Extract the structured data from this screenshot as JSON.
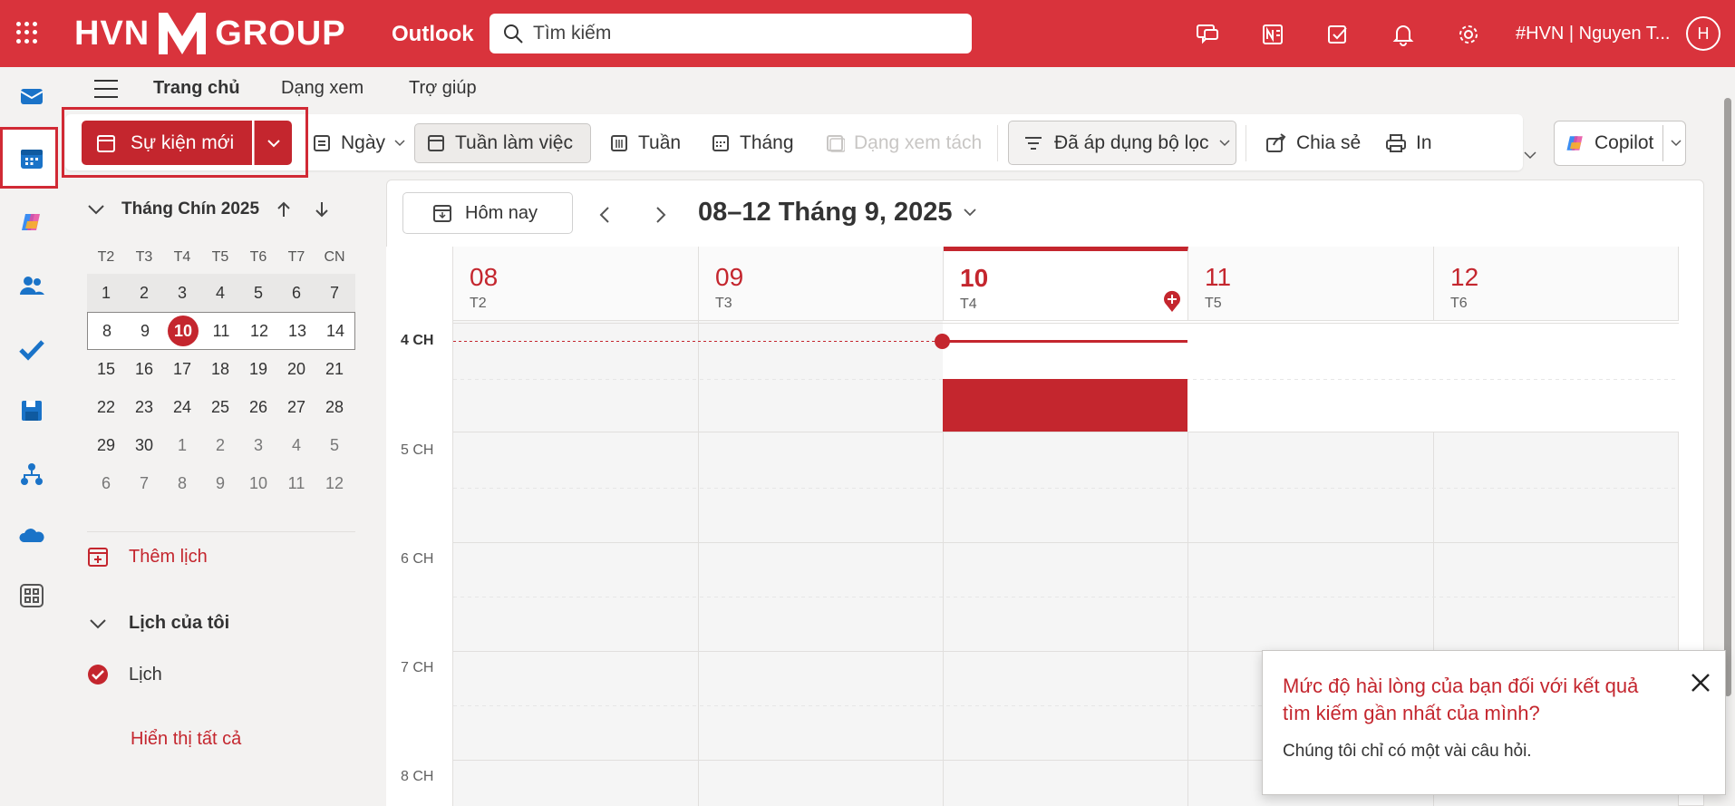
{
  "header": {
    "logo_text_left": "HVN",
    "logo_text_right": "GROUP",
    "app_name": "Outlook",
    "search_placeholder": "Tìm kiếm",
    "user_name": "#HVN | Nguyen T...",
    "avatar_initial": "H",
    "icons": [
      "apps-launcher-icon",
      "teams-chat-icon",
      "onenote-icon",
      "todo-icon",
      "notification-bell-icon",
      "settings-gear-icon"
    ]
  },
  "rail": {
    "items": [
      "mail-icon",
      "calendar-icon",
      "copilot-icon",
      "people-icon",
      "todo-check-icon",
      "save-disk-icon",
      "org-explorer-icon",
      "onedrive-cloud-icon",
      "more-apps-icon"
    ]
  },
  "menu": {
    "tabs": [
      "Trang chủ",
      "Dạng xem",
      "Trợ giúp"
    ]
  },
  "ribbon": {
    "new_event": "Sự kiện mới",
    "day": "Ngày",
    "work_week": "Tuần làm việc",
    "week": "Tuần",
    "month": "Tháng",
    "split_view": "Dạng xem tách",
    "filter": "Đã áp dụng bộ lọc",
    "share": "Chia sẻ",
    "print": "In",
    "copilot": "Copilot"
  },
  "mini_calendar": {
    "title": "Tháng Chín 2025",
    "weekdays": [
      "T2",
      "T3",
      "T4",
      "T5",
      "T6",
      "T7",
      "CN"
    ],
    "weeks": [
      [
        "1",
        "2",
        "3",
        "4",
        "5",
        "6",
        "7"
      ],
      [
        "8",
        "9",
        "10",
        "11",
        "12",
        "13",
        "14"
      ],
      [
        "15",
        "16",
        "17",
        "18",
        "19",
        "20",
        "21"
      ],
      [
        "22",
        "23",
        "24",
        "25",
        "26",
        "27",
        "28"
      ],
      [
        "29",
        "30",
        "1",
        "2",
        "3",
        "4",
        "5"
      ],
      [
        "6",
        "7",
        "8",
        "9",
        "10",
        "11",
        "12"
      ]
    ],
    "today": "10"
  },
  "sidebar": {
    "add_calendar": "Thêm lịch",
    "my_calendars": "Lịch của tôi",
    "calendar_item": "Lịch",
    "show_all": "Hiển thị tất cả"
  },
  "calendar": {
    "today_button": "Hôm nay",
    "range": "08–12 Tháng 9, 2025",
    "days": [
      {
        "num": "08",
        "wd": "T2"
      },
      {
        "num": "09",
        "wd": "T3"
      },
      {
        "num": "10",
        "wd": "T4"
      },
      {
        "num": "11",
        "wd": "T5"
      },
      {
        "num": "12",
        "wd": "T6"
      }
    ],
    "hours": [
      "4 CH",
      "5 CH",
      "6 CH",
      "7 CH",
      "8 CH"
    ],
    "accent": "#c4262e"
  },
  "toast": {
    "title": "Mức độ hài lòng của bạn đối với kết quả tìm kiếm gần nhất của mình?",
    "body": "Chúng tôi chỉ có một vài câu hỏi."
  }
}
